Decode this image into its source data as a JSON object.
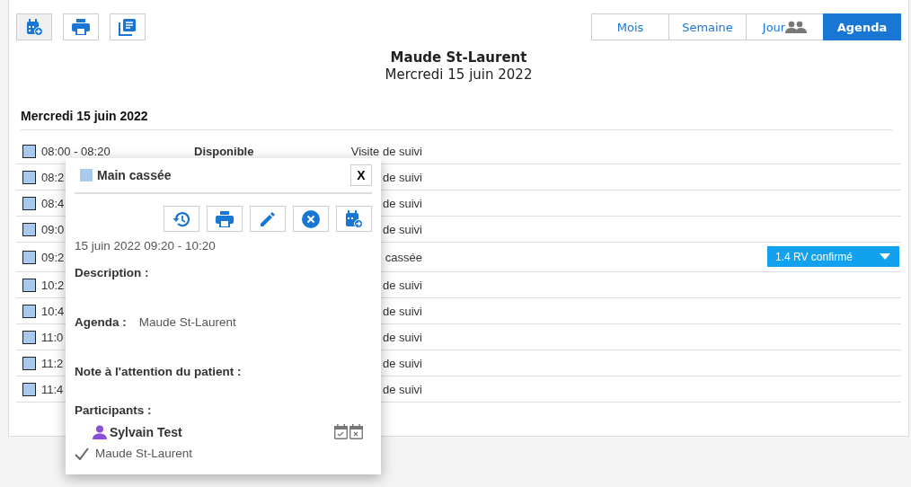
{
  "toolbar": {
    "buttons": [
      {
        "kind": "calendar-add",
        "selected": true
      },
      {
        "kind": "print",
        "selected": false
      },
      {
        "kind": "list",
        "selected": false
      }
    ]
  },
  "views": [
    {
      "label": "Mois",
      "selected": false,
      "people": false
    },
    {
      "label": "Semaine",
      "selected": false,
      "people": false
    },
    {
      "label": "Jour",
      "selected": false,
      "people": true
    },
    {
      "label": "Agenda",
      "selected": true,
      "people": false
    }
  ],
  "header": {
    "name": "Maude St-Laurent",
    "date": "Mercredi 15 juin 2022"
  },
  "day": {
    "title": "Mercredi 15 juin 2022",
    "rows": [
      {
        "time": "08:00 - 08:20",
        "status": "Disponible",
        "type": "Visite de suivi"
      },
      {
        "time": "08:2",
        "type": "de suivi"
      },
      {
        "time": "08:4",
        "type": "de suivi"
      },
      {
        "time": "09:0",
        "type": "de suivi"
      },
      {
        "time": "09:2",
        "type": "cassée",
        "badge": "1.4 RV confirmé"
      },
      {
        "time": "10:2",
        "type": "de suivi"
      },
      {
        "time": "10:4",
        "type": "de suivi"
      },
      {
        "time": "11:0",
        "type": "de suivi"
      },
      {
        "time": "11:2",
        "type": "de suivi"
      },
      {
        "time": "11:4",
        "type": "de suivi"
      }
    ]
  },
  "popup": {
    "title": "Main cassée",
    "close": "X",
    "actions": [
      {
        "kind": "history"
      },
      {
        "kind": "print"
      },
      {
        "kind": "edit"
      },
      {
        "kind": "cancel"
      },
      {
        "kind": "move"
      }
    ],
    "when": "15 juin 2022 09:20 - 10:20",
    "fields": [
      {
        "label": "Description :"
      },
      {
        "label": "Agenda :",
        "value": "Maude St-Laurent"
      },
      {
        "label": "Note à l'attention du patient :"
      }
    ],
    "participants_label": "Participants :",
    "participants": [
      {
        "name": "Sylvain Test",
        "kind": "patient"
      },
      {
        "name": "Maude St-Laurent",
        "kind": "provider"
      }
    ]
  }
}
